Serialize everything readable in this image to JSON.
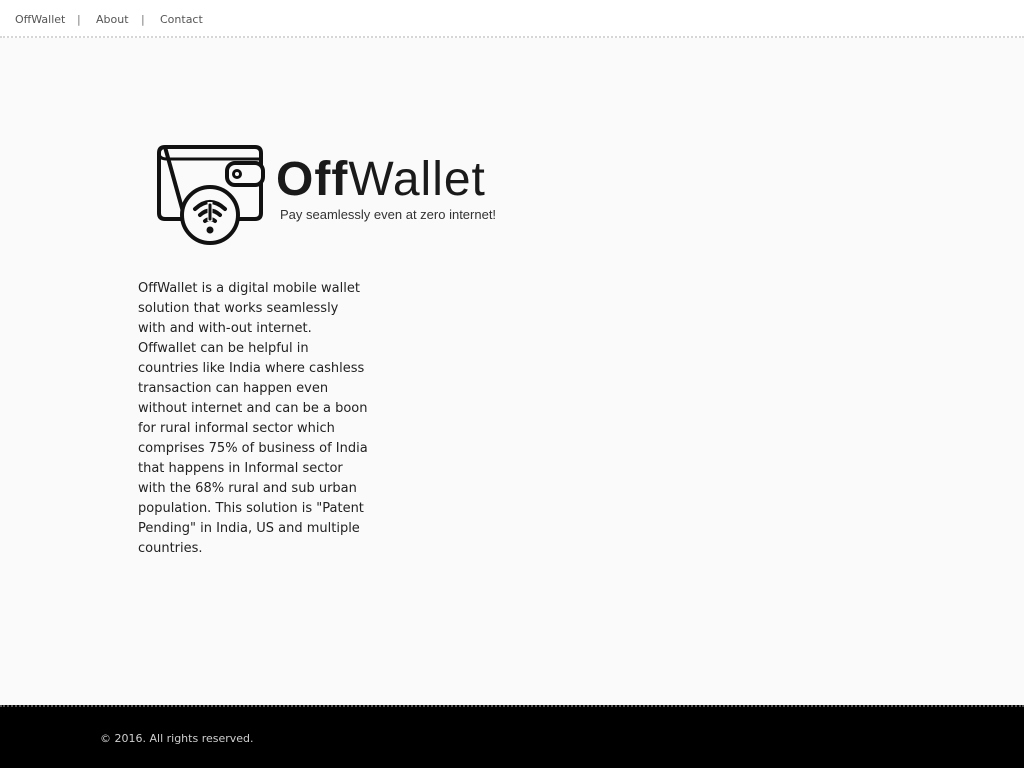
{
  "nav": {
    "brand": "OffWallet",
    "sep1": "|",
    "about": "About",
    "sep2": "|",
    "contact": "Contact"
  },
  "logo": {
    "icon": "wallet-offline-icon",
    "name_bold": "Off",
    "name_light": "Wallet",
    "tagline": "Pay seamlessly even at zero internet!"
  },
  "description": {
    "paragraph1": "OffWallet is a digital mobile wallet solution that works seamlessly with and with-out internet.",
    "paragraph2": "Offwallet can be helpful in countries like India where cashless transaction can happen even without internet and can be a boon for rural informal sector which comprises 75% of business of India that happens in Informal sector with the 68% rural and sub urban population. This solution is \"Patent Pending\" in India, US and multiple countries."
  },
  "footer": {
    "copyright": "© 2016. All rights reserved."
  },
  "colors": {
    "background": "#fafafa",
    "footer": "#000000",
    "text": "#222222"
  }
}
